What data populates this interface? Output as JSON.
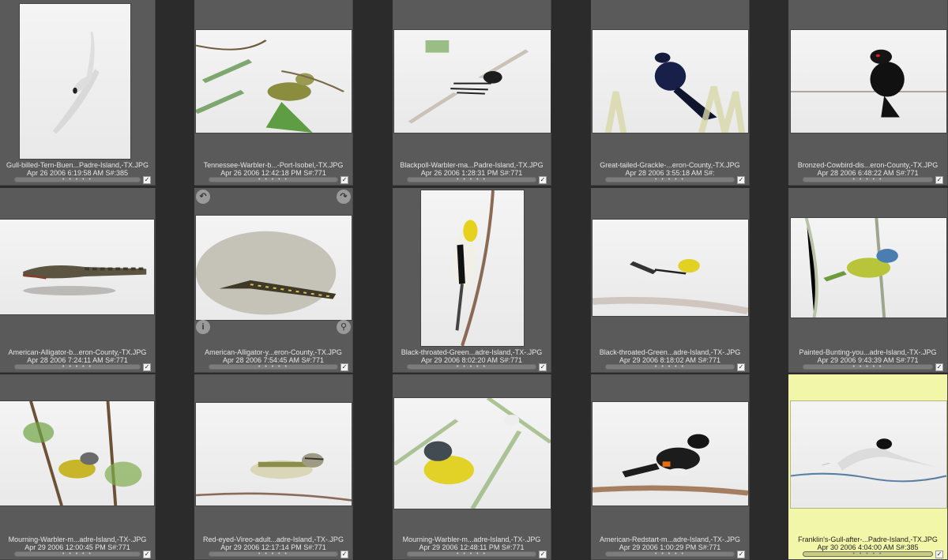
{
  "app": {
    "accent_selected": "#f2f6a8",
    "cell_bg": "#5a5a5a",
    "window_bg": "#2b2b2b"
  },
  "thumbnails": [
    {
      "filename": "Gull-billed-Tern-Buen...Padre-Island,-TX.JPG",
      "meta": "Apr 26 2006 6:19:58 AM S#:385",
      "rating": "• • • • •",
      "checked": true,
      "selected": false,
      "subject": "tern-bird-in-flight"
    },
    {
      "filename": "Tennessee-Warbler-b...-Port-Isobel,-TX.JPG",
      "meta": "Apr 26 2006 12:42:18 PM S#:771",
      "rating": "• • • • •",
      "checked": true,
      "selected": false,
      "subject": "warbler-in-tree"
    },
    {
      "filename": "Blackpoll-Warbler-ma...Padre-Island,-TX.JPG",
      "meta": "Apr 26 2006 1:28:31 PM S#:771",
      "rating": "• • • • •",
      "checked": true,
      "selected": false,
      "subject": "striped-warbler-on-branch"
    },
    {
      "filename": "Great-tailed-Grackle-...eron-County,-TX.JPG",
      "meta": "Apr 28 2006 3:55:18 AM S#:",
      "rating": "• • • • •",
      "checked": true,
      "selected": false,
      "subject": "grackle-on-grass"
    },
    {
      "filename": "Bronzed-Cowbird-dis...eron-County,-TX.JPG",
      "meta": "Apr 28 2006 6:48:22 AM S#:771",
      "rating": "• • • • •",
      "checked": true,
      "selected": false,
      "subject": "cowbird-on-wire"
    },
    {
      "filename": "American-Alligator-b...eron-County,-TX.JPG",
      "meta": "Apr 28 2006 7:24:11 AM S#:771",
      "rating": "• • • • •",
      "checked": true,
      "selected": false,
      "subject": "alligator-in-water"
    },
    {
      "filename": "American-Alligator-y...eron-County,-TX.JPG",
      "meta": "Apr 28 2006 7:54:45 AM S#:771",
      "rating": "• • • • •",
      "checked": true,
      "selected": false,
      "subject": "young-alligator-on-log",
      "hover_controls": true
    },
    {
      "filename": "Black-throated-Green...adre-Island,-TX-.JPG",
      "meta": "Apr 29 2006 8:02:20 AM S#:771",
      "rating": "• • • • •",
      "checked": true,
      "selected": false,
      "subject": "green-warbler-vertical"
    },
    {
      "filename": "Black-throated-Green...adre-Island,-TX-.JPG",
      "meta": "Apr 29 2006 8:18:02 AM S#:771",
      "rating": "• • • • •",
      "checked": true,
      "selected": false,
      "subject": "green-warbler-on-branch"
    },
    {
      "filename": "Painted-Bunting-you...adre-Island,-TX-.JPG",
      "meta": "Apr 29 2006 9:43:39 AM S#:771",
      "rating": "• • • • •",
      "checked": true,
      "selected": false,
      "subject": "bunting-on-stem"
    },
    {
      "filename": "Mourning-Warbler-m...adre-Island,-TX-.JPG",
      "meta": "Apr 29 2006 12:00:45 PM S#:771",
      "rating": "• • • • •",
      "checked": true,
      "selected": false,
      "subject": "mourning-warbler-in-leaves"
    },
    {
      "filename": "Red-eyed-Vireo-adult...adre-Island,-TX-.JPG",
      "meta": "Apr 29 2006 12:17:14 PM S#:771",
      "rating": "• • • • •",
      "checked": true,
      "selected": false,
      "subject": "vireo-on-branch"
    },
    {
      "filename": "Mourning-Warbler-m...adre-Island,-TX-.JPG",
      "meta": "Apr 29 2006 12:48:11 PM S#:771",
      "rating": "• • • • •",
      "checked": true,
      "selected": false,
      "subject": "mourning-warbler-in-fern"
    },
    {
      "filename": "American-Redstart-m...adre-Island,-TX-.JPG",
      "meta": "Apr 29 2006 1:00:29 PM S#:771",
      "rating": "• • • • •",
      "checked": true,
      "selected": false,
      "subject": "redstart-on-branch"
    },
    {
      "filename": "Franklin's-Gull-after-...Padre-Island,-TX.JPG",
      "meta": "Apr 30 2006 4:04:00 AM S#:385",
      "rating": "• • • • •",
      "checked": true,
      "selected": true,
      "subject": "gull-over-water"
    }
  ],
  "controls": {
    "rotate_left_icon": "rotate-left-icon",
    "rotate_right_icon": "rotate-right-icon",
    "info_icon": "info-icon",
    "zoom_icon": "magnifier-icon",
    "rotate_left_glyph": "↶",
    "rotate_right_glyph": "↷",
    "info_glyph": "i",
    "zoom_glyph": "⚲",
    "check_glyph": "✓"
  }
}
